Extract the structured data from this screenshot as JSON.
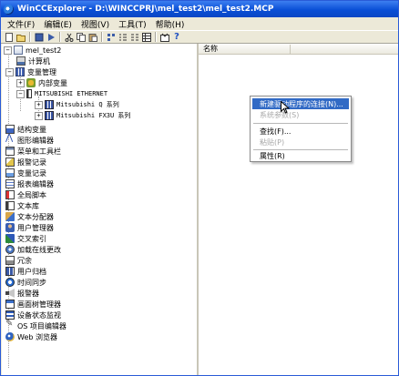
{
  "window": {
    "title": "WinCCExplorer - D:\\WINCCPRJ\\mel_test2\\mel_test2.MCP"
  },
  "menubar": {
    "items": [
      "文件(F)",
      "编辑(E)",
      "视图(V)",
      "工具(T)",
      "帮助(H)"
    ]
  },
  "toolbar": {
    "icons": [
      "new-icon",
      "open-icon",
      "stop-icon",
      "run-icon",
      "cut-icon",
      "copy-icon",
      "paste-icon",
      "large-icons-icon",
      "small-icons-icon",
      "list-icon",
      "details-icon",
      "properties-icon",
      "help-icon"
    ],
    "help_label": "?"
  },
  "tree": {
    "root": "mel_test2",
    "items": [
      {
        "label": "计算机",
        "icon": "computer-icon"
      },
      {
        "label": "变量管理",
        "icon": "tag-management-icon"
      },
      {
        "label": "内部变量",
        "icon": "internal-tags-icon"
      },
      {
        "label": "MITSUBISHI ETHERNET",
        "icon": "channel-icon"
      },
      {
        "label": "Mitsubishi Q 系列",
        "icon": "connection-icon"
      },
      {
        "label": "Mitsubishi FX3U 系列",
        "icon": "connection-icon"
      },
      {
        "label": "结构变量",
        "icon": "structure-tags-icon"
      },
      {
        "label": "图形编辑器",
        "icon": "graphics-designer-icon"
      },
      {
        "label": "菜单和工具栏",
        "icon": "menus-toolbars-icon"
      },
      {
        "label": "报警记录",
        "icon": "alarm-logging-icon"
      },
      {
        "label": "变量记录",
        "icon": "tag-logging-icon"
      },
      {
        "label": "报表编辑器",
        "icon": "report-designer-icon"
      },
      {
        "label": "全局脚本",
        "icon": "global-script-icon"
      },
      {
        "label": "文本库",
        "icon": "text-library-icon"
      },
      {
        "label": "文本分配器",
        "icon": "text-distributor-icon"
      },
      {
        "label": "用户管理器",
        "icon": "user-administrator-icon"
      },
      {
        "label": "交叉索引",
        "icon": "cross-reference-icon"
      },
      {
        "label": "加载在线更改",
        "icon": "load-online-changes-icon"
      },
      {
        "label": "冗余",
        "icon": "redundancy-icon"
      },
      {
        "label": "用户归档",
        "icon": "user-archive-icon"
      },
      {
        "label": "时间同步",
        "icon": "time-sync-icon"
      },
      {
        "label": "报警器",
        "icon": "horn-icon"
      },
      {
        "label": "画面树管理器",
        "icon": "picture-tree-icon"
      },
      {
        "label": "设备状态监视",
        "icon": "device-status-icon"
      },
      {
        "label": "OS 项目编辑器",
        "icon": "os-project-editor-icon"
      },
      {
        "label": "Web 浏览器",
        "icon": "web-navigator-icon"
      }
    ]
  },
  "list": {
    "column_name": "名称"
  },
  "context_menu": {
    "items": [
      {
        "label": "新建驱动程序的连接(N)...",
        "state": "highlight"
      },
      {
        "label": "系统参数(S)",
        "state": "disabled"
      },
      {
        "label": "查找(F)...",
        "state": "normal"
      },
      {
        "label": "粘贴(P)",
        "state": "disabled"
      },
      {
        "label": "属性(R)",
        "state": "normal"
      }
    ]
  },
  "colors": {
    "titlebar": "#0a4fd6",
    "menu_highlight": "#316ac5",
    "chrome": "#ece9d8"
  }
}
